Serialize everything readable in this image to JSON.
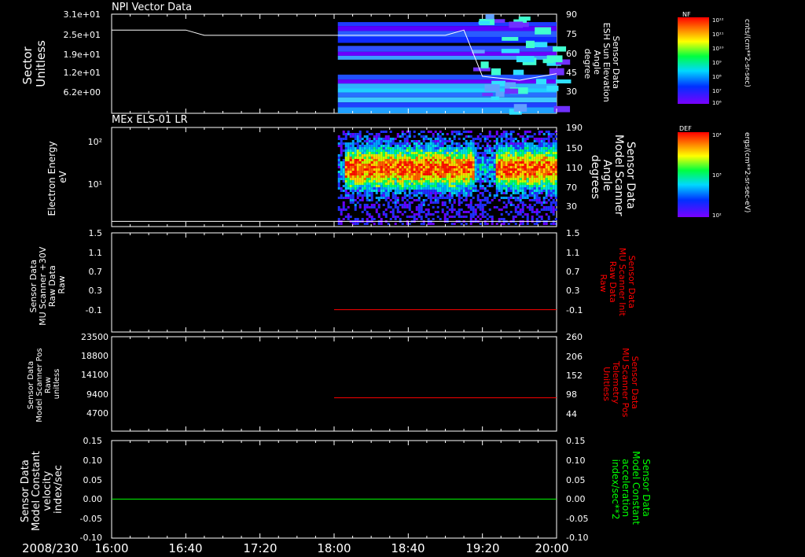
{
  "time_axis": {
    "date_label": "2008/230",
    "ticks": [
      "16:00",
      "16:40",
      "17:20",
      "18:00",
      "18:40",
      "19:20",
      "20:00"
    ]
  },
  "colorbars": [
    {
      "tag": "NF",
      "unit_label": "cnts/(cm**2-sr-sec)",
      "tick_labels": [
        "10¹²",
        "10¹¹",
        "10¹⁰",
        "10⁹",
        "10⁸",
        "10⁷",
        "10⁶"
      ]
    },
    {
      "tag": "DEF",
      "unit_label": "ergs/(cm**2-sr-sec-eV)",
      "tick_labels": [
        "10⁴",
        "10³",
        "10²"
      ]
    }
  ],
  "colors": {
    "white": "#ffffff",
    "red": "#ff0000",
    "green": "#00ff00",
    "background": "#000000"
  },
  "chart_data": [
    {
      "type": "heatmap",
      "title": "NPI Vector Data",
      "left_axis_label": [
        "Sector",
        "Unitless"
      ],
      "left_ticks": [
        "3.1e+01",
        "2.5e+01",
        "1.9e+01",
        "1.2e+01",
        "6.2e+00"
      ],
      "right_axis_label": [
        "Sensor Data",
        "ESH Sun Elevation",
        "Angle",
        "degree"
      ],
      "right_ticks": [
        "90",
        "75",
        "60",
        "45",
        "30"
      ],
      "ylim_right": [
        15,
        90
      ],
      "line_color": "#ffffff",
      "line_series": {
        "x": [
          "16:00",
          "16:40",
          "16:50",
          "17:20",
          "18:00",
          "18:40",
          "19:00",
          "19:10",
          "19:20",
          "19:40",
          "20:00"
        ],
        "y": [
          78,
          78,
          74,
          74,
          74,
          74,
          74,
          78,
          43,
          40,
          45
        ]
      },
      "heatmap_start": "18:02"
    },
    {
      "type": "heatmap",
      "title": "MEx ELS-01 LR",
      "left_axis_label": [
        "Electron Energy",
        "eV"
      ],
      "left_ticks": [
        "10²",
        "10¹"
      ],
      "right_axis_label": [
        "Sensor Data",
        "Model Scanner",
        "Angle",
        "degrees"
      ],
      "right_ticks": [
        "190",
        "150",
        "110",
        "70",
        "30"
      ],
      "ylim_right": [
        0,
        190
      ],
      "line_color": "#ffffff",
      "line_series": {
        "x": [
          "16:00",
          "20:00"
        ],
        "y": [
          10,
          10
        ]
      },
      "heatmap_start": "18:02"
    },
    {
      "type": "line",
      "title": "",
      "left_axis_label": [
        "Sensor Data",
        "MU Scanner +30V",
        "Raw Data",
        "Raw"
      ],
      "left_ticks": [
        "1.5",
        "1.1",
        "0.7",
        "0.3",
        "-0.1"
      ],
      "right_axis_label": [
        "Sensor Data",
        "MU Scanner Init",
        "Raw Data",
        "Raw"
      ],
      "right_ticks": [
        "1.5",
        "1.1",
        "0.7",
        "0.3",
        "-0.1"
      ],
      "ylim": [
        -0.5,
        1.5
      ],
      "line_color": "#ff0000",
      "line_series": {
        "x": [
          "18:00",
          "20:00"
        ],
        "y": [
          -0.05,
          -0.05
        ]
      }
    },
    {
      "type": "line",
      "title": "",
      "left_axis_label": [
        "Sensor Data",
        "Model Scanner Pos",
        "Raw",
        "unitless"
      ],
      "left_ticks": [
        "23500",
        "18800",
        "14100",
        "9400",
        "4700"
      ],
      "right_axis_label": [
        "Sensor Data",
        "MU Scanner Pos",
        "Telemetry",
        "Unitless"
      ],
      "right_ticks": [
        "260",
        "206",
        "152",
        "98",
        "44"
      ],
      "ylim": [
        0,
        23500
      ],
      "line_color": "#ff0000",
      "line_series": {
        "x": [
          "18:00",
          "20:00"
        ],
        "y": [
          8300,
          8300
        ]
      }
    },
    {
      "type": "line",
      "title": "",
      "left_axis_label": [
        "Sensor Data",
        "Model Constant",
        "velocity",
        "index/sec"
      ],
      "left_ticks": [
        "0.15",
        "0.10",
        "0.05",
        "0.00",
        "-0.05",
        "-0.10"
      ],
      "right_axis_label": [
        "Sensor Data",
        "Model Constant",
        "acceleration",
        "index/sec**2"
      ],
      "right_ticks": [
        "0.15",
        "0.10",
        "0.05",
        "0.00",
        "-0.05",
        "-0.10"
      ],
      "ylim": [
        -0.1,
        0.15
      ],
      "line_color": "#00ff00",
      "line_series": {
        "x": [
          "16:00",
          "20:00"
        ],
        "y": [
          0,
          0
        ]
      }
    }
  ]
}
